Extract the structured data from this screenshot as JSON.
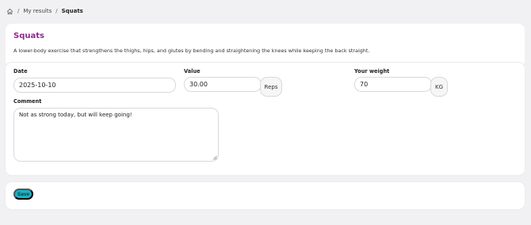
{
  "breadcrumb": {
    "home_icon": "home-icon",
    "separator": "/",
    "items": [
      "My results",
      "Squats"
    ]
  },
  "exercise": {
    "title": "Squats",
    "description": "A lower-body exercise that strengthens the thighs, hips, and glutes by bending and straightening the knees while keeping the back straight."
  },
  "form": {
    "date": {
      "label": "Date",
      "value": "2025-10-10"
    },
    "value": {
      "label": "Value",
      "value": "30.00",
      "unit": "Reps"
    },
    "weight": {
      "label": "Your weight",
      "value": "70",
      "unit": "KG"
    },
    "comment": {
      "label": "Comment",
      "value": "Not as strong today, but will keep going!"
    }
  },
  "actions": {
    "save_label": "Save"
  },
  "colors": {
    "title": "#8e2a8e",
    "save_button": "#17b3c4",
    "background": "#f1f1f3"
  }
}
